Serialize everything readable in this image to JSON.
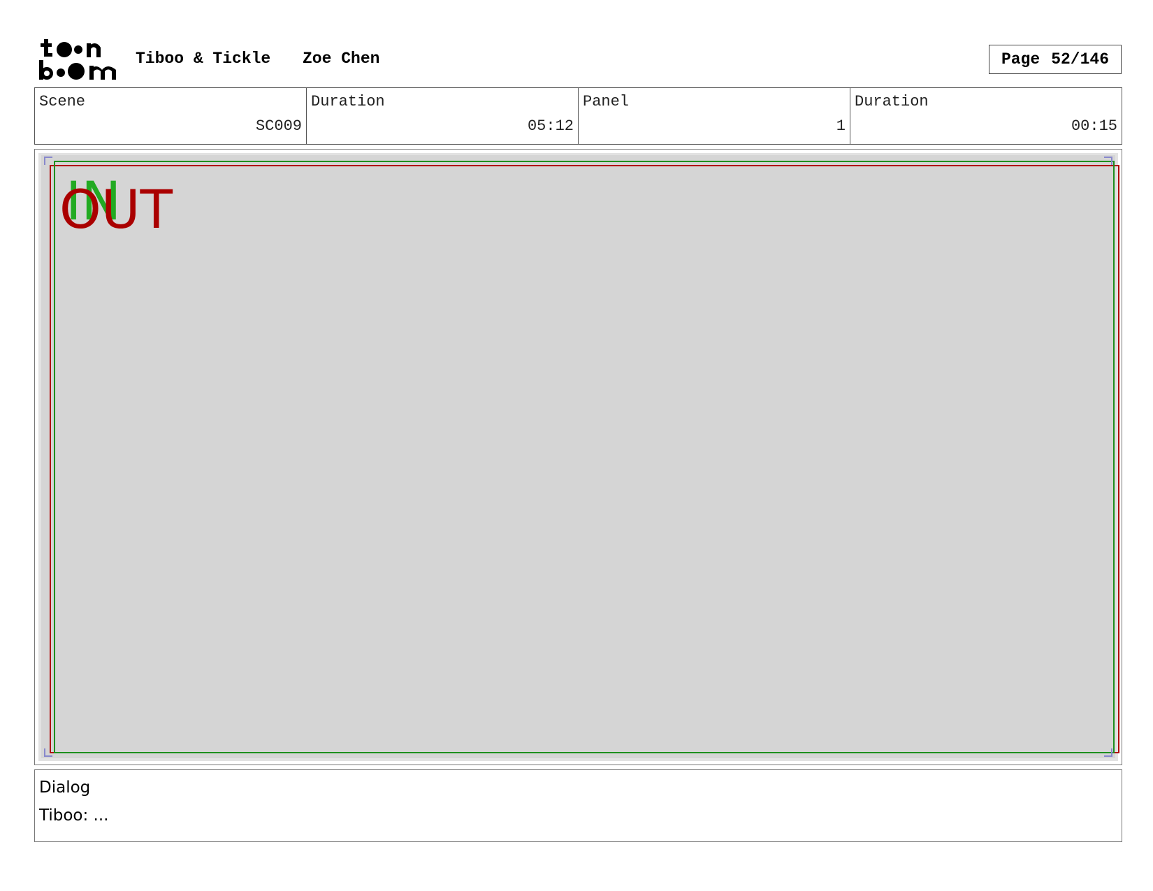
{
  "header": {
    "logo_text": "toon boom",
    "project": "Tiboo & Tickle",
    "author": "Zoe Chen",
    "page_label": "Page",
    "page_value": "52/146"
  },
  "info": {
    "scene_label": "Scene",
    "scene_value": "SC009",
    "scene_duration_label": "Duration",
    "scene_duration_value": "05:12",
    "panel_label": "Panel",
    "panel_value": "1",
    "panel_duration_label": "Duration",
    "panel_duration_value": "00:15"
  },
  "panel": {
    "in_label": "IN",
    "out_label": "OUT",
    "colors": {
      "in": "#22aa22",
      "out": "#aa0000",
      "background": "#d5d5d5"
    }
  },
  "dialog": {
    "label": "Dialog",
    "text": "Tiboo: ..."
  }
}
